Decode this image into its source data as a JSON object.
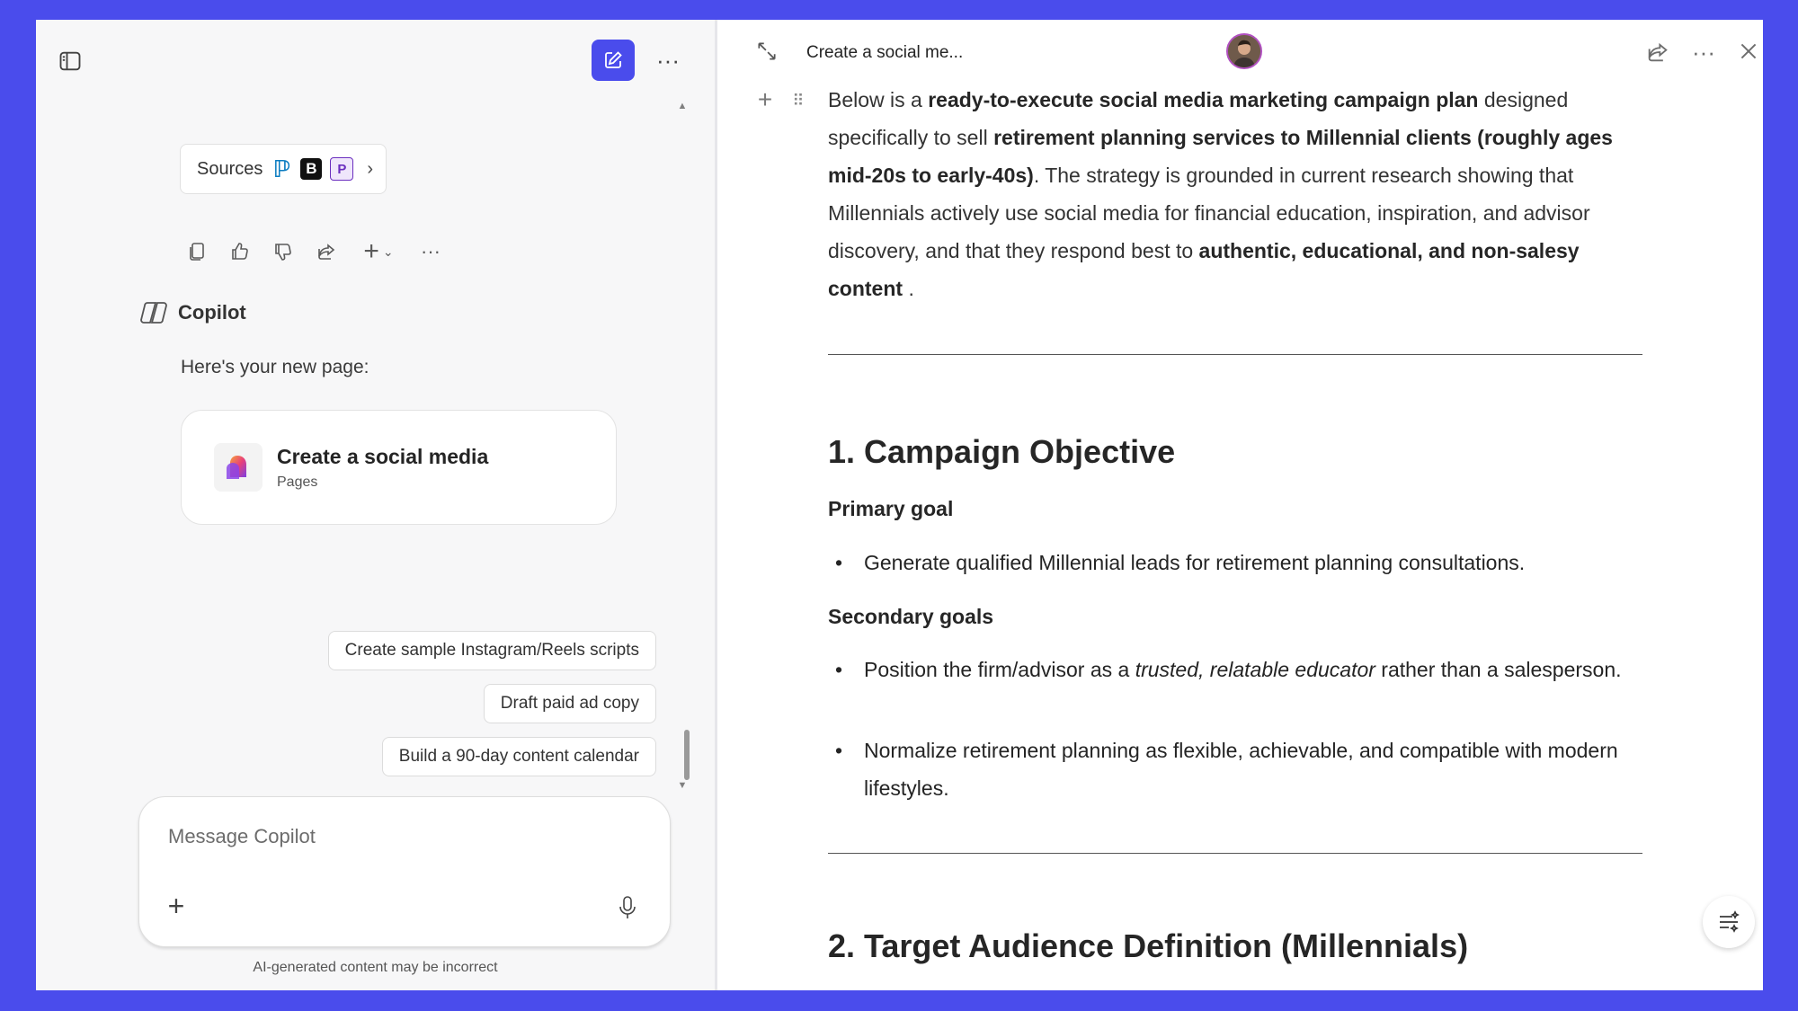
{
  "left_panel": {
    "sources": {
      "label": "Sources",
      "icons": [
        "pinterest-icon",
        "b-logo-icon",
        "p-logo-icon"
      ]
    },
    "actions": [
      "copy-icon",
      "thumbs-up-icon",
      "thumbs-down-icon",
      "share-icon",
      "plus-icon",
      "chevron-down-icon",
      "more-icon"
    ],
    "assistant_name": "Copilot",
    "intro": "Here's your new page:",
    "page_card": {
      "title": "Create a social media",
      "subtitle": "Pages"
    },
    "suggestions": [
      "Create sample Instagram/Reels scripts",
      "Draft paid ad copy",
      "Build a 90-day content calendar"
    ],
    "composer": {
      "placeholder": "Message Copilot"
    },
    "disclaimer": "AI-generated content may be incorrect",
    "accent_color": "#4a4cec"
  },
  "right_panel": {
    "tab_title": "Create a social me...",
    "intro": {
      "p1": "Below is a ",
      "b1": "ready-to-execute social media marketing campaign plan",
      "p2": " designed specifically to sell ",
      "b2": "retirement planning services to Millennial clients (roughly ages mid-20s to early-40s)",
      "p3": ". The strategy is grounded in current research showing that Millennials actively use social media for financial education, inspiration, and advisor discovery, and that they respond best to ",
      "b3": "authentic, educational, and non-salesy content",
      "p4": " ."
    },
    "section1": {
      "heading": "1. Campaign Objective",
      "primary_label": "Primary goal",
      "primary_items": [
        "Generate qualified Millennial leads for retirement planning consultations."
      ],
      "secondary_label": "Secondary goals",
      "secondary_item1": {
        "pre": "Position the firm/advisor as a ",
        "italic": "trusted, relatable educator",
        "post": " rather than a salesperson."
      },
      "secondary_item2": "Normalize retirement planning as flexible, achievable, and compatible with modern lifestyles."
    },
    "section2": {
      "heading": "2. Target Audience Definition (Millennials)"
    },
    "bullet_char": "•"
  }
}
